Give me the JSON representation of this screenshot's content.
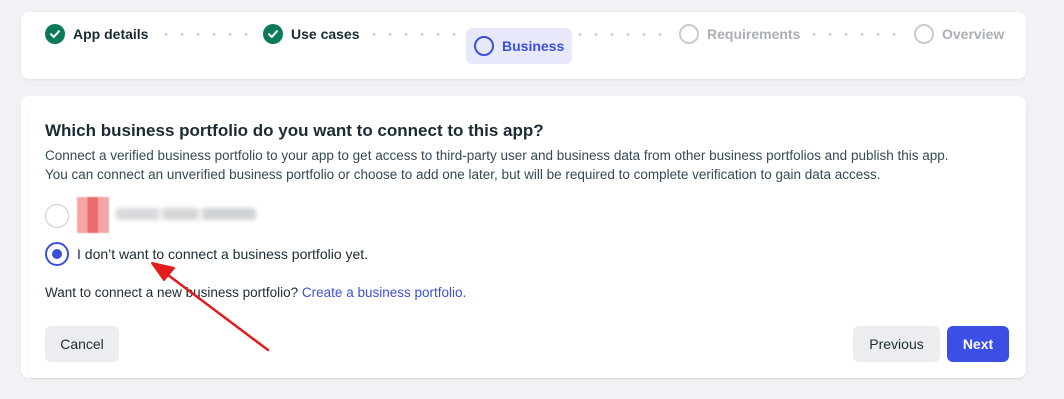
{
  "stepper": {
    "steps": [
      {
        "label": "App details",
        "state": "done"
      },
      {
        "label": "Use cases",
        "state": "done"
      },
      {
        "label": "Business",
        "state": "active"
      },
      {
        "label": "Requirements",
        "state": "todo"
      },
      {
        "label": "Overview",
        "state": "todo"
      }
    ]
  },
  "business": {
    "title": "Which business portfolio do you want to connect to this app?",
    "description_line1": "Connect a verified business portfolio to your app to get access to third-party user and business data from other business portfolios and publish this app.",
    "description_line2": "You can connect an unverified business portfolio or choose to add one later, but will be required to complete verification to gain data access.",
    "options": {
      "no_portfolio_label": "I don’t want to connect a business portfolio yet.",
      "selected": "no_portfolio"
    },
    "connect_prompt": "Want to connect a new business portfolio?",
    "connect_link": "Create a business portfolio."
  },
  "actions": {
    "cancel_label": "Cancel",
    "previous_label": "Previous",
    "next_label": "Next"
  },
  "colors": {
    "accent": "#3b4fdb",
    "done_green": "#0a7a5a",
    "annotation_red": "#e21b1b"
  }
}
